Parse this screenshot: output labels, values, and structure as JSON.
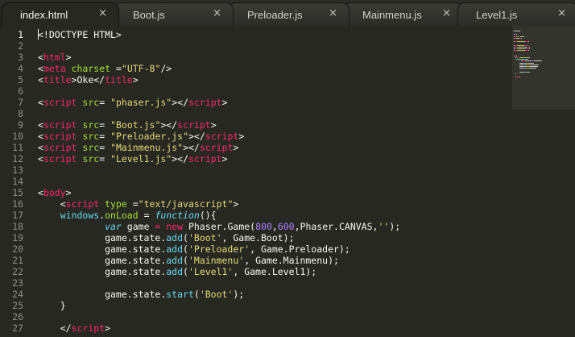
{
  "colors": {
    "background": "#272822",
    "tag": "#f92672",
    "attribute": "#a6e22e",
    "string": "#e6db74",
    "keyword": "#f92672",
    "function": "#66d9ef",
    "number": "#ae81ff",
    "plain": "#f8f8f2",
    "line_number": "#8f908a"
  },
  "tabs": [
    {
      "label": "index.html",
      "close": "×",
      "active": true
    },
    {
      "label": "Boot.js",
      "close": "×",
      "active": false
    },
    {
      "label": "Preloader.js",
      "close": "×",
      "active": false
    },
    {
      "label": "Mainmenu.js",
      "close": "×",
      "active": false
    },
    {
      "label": "Level1.js",
      "close": "×",
      "active": false
    }
  ],
  "editor": {
    "current_line": 1,
    "lines": [
      {
        "n": "1",
        "tokens": [
          [
            "<!DOCTYPE HTML>",
            "plain"
          ]
        ]
      },
      {
        "n": "2",
        "tokens": []
      },
      {
        "n": "3",
        "tokens": [
          [
            "<",
            "plain"
          ],
          [
            "html",
            "tag"
          ],
          [
            ">",
            "plain"
          ]
        ]
      },
      {
        "n": "4",
        "tokens": [
          [
            "<",
            "plain"
          ],
          [
            "meta",
            "tag"
          ],
          [
            " ",
            "plain"
          ],
          [
            "charset",
            "attr"
          ],
          [
            " =",
            "plain"
          ],
          [
            "\"UTF-8\"",
            "str"
          ],
          [
            "/>",
            "plain"
          ]
        ]
      },
      {
        "n": "5",
        "tokens": [
          [
            "<",
            "plain"
          ],
          [
            "title",
            "tag"
          ],
          [
            ">Oke</",
            "plain"
          ],
          [
            "title",
            "tag"
          ],
          [
            ">",
            "plain"
          ]
        ]
      },
      {
        "n": "6",
        "tokens": []
      },
      {
        "n": "7",
        "tokens": [
          [
            "<",
            "plain"
          ],
          [
            "script",
            "tag"
          ],
          [
            " ",
            "plain"
          ],
          [
            "src",
            "attr"
          ],
          [
            "= ",
            "plain"
          ],
          [
            "\"phaser.js\"",
            "str"
          ],
          [
            "></",
            "plain"
          ],
          [
            "script",
            "tag"
          ],
          [
            ">",
            "plain"
          ]
        ]
      },
      {
        "n": "8",
        "tokens": []
      },
      {
        "n": "9",
        "tokens": [
          [
            "<",
            "plain"
          ],
          [
            "script",
            "tag"
          ],
          [
            " ",
            "plain"
          ],
          [
            "src",
            "attr"
          ],
          [
            "= ",
            "plain"
          ],
          [
            "\"Boot.js\"",
            "str"
          ],
          [
            "></",
            "plain"
          ],
          [
            "script",
            "tag"
          ],
          [
            ">",
            "plain"
          ]
        ]
      },
      {
        "n": "10",
        "tokens": [
          [
            "<",
            "plain"
          ],
          [
            "script",
            "tag"
          ],
          [
            " ",
            "plain"
          ],
          [
            "src",
            "attr"
          ],
          [
            "= ",
            "plain"
          ],
          [
            "\"Preloader.js\"",
            "str"
          ],
          [
            "></",
            "plain"
          ],
          [
            "script",
            "tag"
          ],
          [
            ">",
            "plain"
          ]
        ]
      },
      {
        "n": "11",
        "tokens": [
          [
            "<",
            "plain"
          ],
          [
            "script",
            "tag"
          ],
          [
            " ",
            "plain"
          ],
          [
            "src",
            "attr"
          ],
          [
            "= ",
            "plain"
          ],
          [
            "\"Mainmenu.js\"",
            "str"
          ],
          [
            "></",
            "plain"
          ],
          [
            "script",
            "tag"
          ],
          [
            ">",
            "plain"
          ]
        ]
      },
      {
        "n": "12",
        "tokens": [
          [
            "<",
            "plain"
          ],
          [
            "script",
            "tag"
          ],
          [
            " ",
            "plain"
          ],
          [
            "src",
            "attr"
          ],
          [
            "= ",
            "plain"
          ],
          [
            "\"Level1.js\"",
            "str"
          ],
          [
            "></",
            "plain"
          ],
          [
            "script",
            "tag"
          ],
          [
            ">",
            "plain"
          ]
        ]
      },
      {
        "n": "13",
        "tokens": []
      },
      {
        "n": "14",
        "tokens": []
      },
      {
        "n": "15",
        "tokens": [
          [
            "<",
            "plain"
          ],
          [
            "body",
            "tag"
          ],
          [
            ">",
            "plain"
          ]
        ]
      },
      {
        "n": "16",
        "tokens": [
          [
            "    <",
            "plain"
          ],
          [
            "script",
            "tag"
          ],
          [
            " ",
            "plain"
          ],
          [
            "type",
            "attr"
          ],
          [
            " =",
            "plain"
          ],
          [
            "\"text/javascript\"",
            "str"
          ],
          [
            ">",
            "plain"
          ]
        ]
      },
      {
        "n": "17",
        "tokens": [
          [
            "    ",
            "plain"
          ],
          [
            "windows",
            "fn"
          ],
          [
            ".",
            "plain"
          ],
          [
            "onLoad",
            "attr"
          ],
          [
            " = ",
            "plain"
          ],
          [
            "function",
            "var"
          ],
          [
            "(){",
            "plain"
          ]
        ]
      },
      {
        "n": "18",
        "tokens": [
          [
            "            ",
            "plain"
          ],
          [
            "var",
            "var"
          ],
          [
            " game ",
            "plain"
          ],
          [
            "=",
            "kw"
          ],
          [
            " ",
            "plain"
          ],
          [
            "new",
            "kw"
          ],
          [
            " Phaser.Game(",
            "plain"
          ],
          [
            "800",
            "num"
          ],
          [
            ",",
            "plain"
          ],
          [
            "600",
            "num"
          ],
          [
            ",Phaser.CANVAS,",
            "plain"
          ],
          [
            "''",
            "str"
          ],
          [
            ");",
            "plain"
          ]
        ]
      },
      {
        "n": "19",
        "tokens": [
          [
            "            game.state.",
            "plain"
          ],
          [
            "add",
            "fn"
          ],
          [
            "(",
            "plain"
          ],
          [
            "'Boot'",
            "str"
          ],
          [
            ", Game.Boot);",
            "plain"
          ]
        ]
      },
      {
        "n": "20",
        "tokens": [
          [
            "            game.state.",
            "plain"
          ],
          [
            "add",
            "fn"
          ],
          [
            "(",
            "plain"
          ],
          [
            "'Preloader'",
            "str"
          ],
          [
            ", Game.Preloader);",
            "plain"
          ]
        ]
      },
      {
        "n": "21",
        "tokens": [
          [
            "            game.state.",
            "plain"
          ],
          [
            "add",
            "fn"
          ],
          [
            "(",
            "plain"
          ],
          [
            "'Mainmenu'",
            "str"
          ],
          [
            ", Game.Mainmenu);",
            "plain"
          ]
        ]
      },
      {
        "n": "22",
        "tokens": [
          [
            "            game.state.",
            "plain"
          ],
          [
            "add",
            "fn"
          ],
          [
            "(",
            "plain"
          ],
          [
            "'Level1'",
            "str"
          ],
          [
            ", Game.Level1);",
            "plain"
          ]
        ]
      },
      {
        "n": "23",
        "tokens": []
      },
      {
        "n": "24",
        "tokens": [
          [
            "            game.state.",
            "plain"
          ],
          [
            "start",
            "fn"
          ],
          [
            "(",
            "plain"
          ],
          [
            "'Boot'",
            "str"
          ],
          [
            ");",
            "plain"
          ]
        ]
      },
      {
        "n": "25",
        "tokens": [
          [
            "    }",
            "plain"
          ]
        ]
      },
      {
        "n": "26",
        "tokens": []
      },
      {
        "n": "27",
        "tokens": [
          [
            "    </",
            "plain"
          ],
          [
            "script",
            "tag"
          ],
          [
            ">",
            "plain"
          ]
        ]
      }
    ]
  }
}
